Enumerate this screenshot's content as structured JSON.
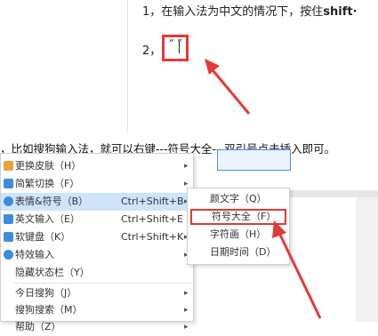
{
  "doc": {
    "line1_prefix": "1，在输入法为中文的情况下，按住",
    "line1_bold": "shift·",
    "line2_num": "2，",
    "quote": "“  ”"
  },
  "caption": "，比如搜狗输入法，就可以右键---符号大全---双引号点击插入即可。",
  "blue_button": "　　　　",
  "menu": {
    "items": [
      {
        "label": "更换皮肤（H）",
        "shortcut": "",
        "arrow": "▸",
        "icon_color": "#e8a33c"
      },
      {
        "label": "简繁切换（F）",
        "shortcut": "",
        "arrow": "▸",
        "icon_color": "#3b8de0"
      },
      {
        "label": "表情&符号（B）",
        "shortcut": "Ctrl+Shift+B",
        "arrow": "▸",
        "icon_color": "#3b8de0"
      },
      {
        "label": "英文输入（E）",
        "shortcut": "Ctrl+Shift+E",
        "arrow": "",
        "icon_color": "#3b8de0"
      },
      {
        "label": "软键盘（K）",
        "shortcut": "Ctrl+Shift+K",
        "arrow": "▸",
        "icon_color": "#3b8de0"
      },
      {
        "label": "特效输入",
        "shortcut": "",
        "arrow": "▸",
        "icon_color": "#3b8de0"
      },
      {
        "label": "隐藏状态栏（Y）",
        "shortcut": "",
        "arrow": "",
        "icon_color": ""
      },
      {
        "label": "今日搜狗（J）",
        "shortcut": "",
        "arrow": "▸",
        "icon_color": ""
      },
      {
        "label": "搜狗搜索（M）",
        "shortcut": "",
        "arrow": "▸",
        "icon_color": ""
      },
      {
        "label": "帮助（Z）",
        "shortcut": "",
        "arrow": "▸",
        "icon_color": ""
      }
    ]
  },
  "submenu": {
    "items": [
      {
        "label": "颜文字（Q）"
      },
      {
        "label": "符号大全（F）"
      },
      {
        "label": "字符画（H）"
      },
      {
        "label": "日期时间（D）"
      }
    ]
  },
  "colors": {
    "annotation_red": "#e53935",
    "menu_highlight": "#cde5fb"
  }
}
